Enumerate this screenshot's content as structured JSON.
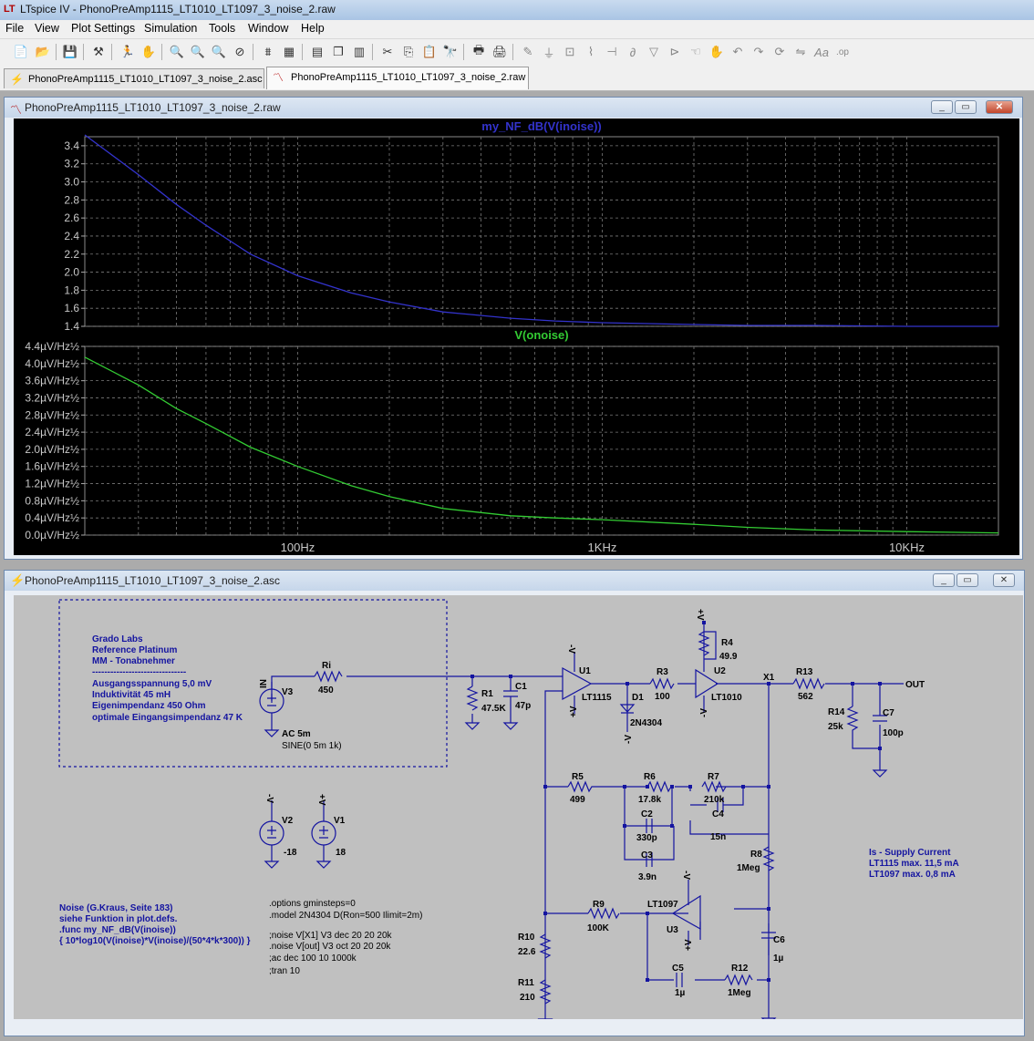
{
  "app": {
    "title": "LTspice IV - PhonoPreAmp1115_LT1010_LT1097_3_noise_2.raw",
    "icon_name": "ltspice-logo-icon"
  },
  "menu": [
    "File",
    "View",
    "Plot Settings",
    "Simulation",
    "Tools",
    "Window",
    "Help"
  ],
  "toolbar_icons": [
    "new-schematic-icon",
    "open-icon",
    "save-icon",
    "control-panel-icon",
    "run-icon",
    "halt-icon",
    "zoom-in-icon",
    "zoom-out-icon",
    "zoom-fit-icon",
    "zoom-cancel-icon",
    "autorange-icon",
    "grid-icon",
    "tile-horizontal-icon",
    "cascade-icon",
    "tile-vertical-icon",
    "cut-icon",
    "copy-icon",
    "paste-icon",
    "find-icon",
    "print-setup-icon",
    "print-icon",
    "wire-icon",
    "ground-icon",
    "label-icon",
    "resistor-icon",
    "capacitor-icon",
    "inductor-icon",
    "diode-icon",
    "component-icon",
    "move-icon",
    "drag-icon",
    "undo-icon",
    "redo-icon",
    "rotate-icon",
    "mirror-icon",
    "text-icon",
    "spice-directive-icon"
  ],
  "tabs": [
    {
      "label": "PhonoPreAmp1115_LT1010_LT1097_3_noise_2.asc",
      "icon": "schematic-icon",
      "active": false
    },
    {
      "label": "PhonoPreAmp1115_LT1010_LT1097_3_noise_2.raw",
      "icon": "waveform-icon",
      "active": true
    }
  ],
  "plot_window": {
    "title": "PhonoPreAmp1115_LT1010_LT1097_3_noise_2.raw",
    "buttons": [
      "_",
      "▭",
      "✕"
    ]
  },
  "schematic_window": {
    "title": "PhonoPreAmp1115_LT1010_LT1097_3_noise_2.asc",
    "buttons": [
      "_",
      "▭",
      "✕"
    ]
  },
  "chart_data": [
    {
      "type": "line",
      "title": "my_NF_dB(V(inoise))",
      "color": "#3333cc",
      "x_scale": "log",
      "xlim": [
        20,
        20000
      ],
      "ylim": [
        1.4,
        3.5
      ],
      "yticks": [
        "3.4",
        "3.2",
        "3.0",
        "2.8",
        "2.6",
        "2.4",
        "2.2",
        "2.0",
        "1.8",
        "1.6",
        "1.4"
      ],
      "ytick_values": [
        3.4,
        3.2,
        3.0,
        2.8,
        2.6,
        2.4,
        2.2,
        2.0,
        1.8,
        1.6,
        1.4
      ],
      "x": [
        20,
        30,
        40,
        50,
        70,
        100,
        150,
        200,
        300,
        500,
        700,
        1000,
        2000,
        3000,
        5000,
        10000,
        20000
      ],
      "y": [
        3.52,
        3.08,
        2.75,
        2.52,
        2.2,
        1.96,
        1.77,
        1.67,
        1.56,
        1.49,
        1.46,
        1.44,
        1.42,
        1.41,
        1.41,
        1.4,
        1.4
      ],
      "grid": true
    },
    {
      "type": "line",
      "title": "V(onoise)",
      "color": "#33cc33",
      "x_scale": "log",
      "xlim": [
        20,
        20000
      ],
      "ylim": [
        0,
        4.4
      ],
      "yticks": [
        "4.4µV/Hz½",
        "4.0µV/Hz½",
        "3.6µV/Hz½",
        "3.2µV/Hz½",
        "2.8µV/Hz½",
        "2.4µV/Hz½",
        "2.0µV/Hz½",
        "1.6µV/Hz½",
        "1.2µV/Hz½",
        "0.8µV/Hz½",
        "0.4µV/Hz½",
        "0.0µV/Hz½"
      ],
      "ytick_values": [
        4.4,
        4.0,
        3.6,
        3.2,
        2.8,
        2.4,
        2.0,
        1.6,
        1.2,
        0.8,
        0.4,
        0.0
      ],
      "x": [
        20,
        30,
        40,
        50,
        70,
        100,
        150,
        200,
        300,
        500,
        700,
        1000,
        2000,
        3000,
        5000,
        10000,
        20000
      ],
      "y": [
        4.15,
        3.5,
        2.95,
        2.6,
        2.05,
        1.6,
        1.15,
        0.9,
        0.62,
        0.45,
        0.4,
        0.36,
        0.25,
        0.18,
        0.12,
        0.08,
        0.05
      ],
      "grid": true,
      "xtick_labels": [
        "100Hz",
        "1KHz",
        "10KHz"
      ],
      "xtick_values": [
        100,
        1000,
        10000
      ]
    }
  ],
  "schematic": {
    "note_box": [
      "Grado Labs",
      "Reference Platinum",
      "MM - Tonabnehmer",
      "-------------------------------",
      "Ausgangsspannung 5,0 mV",
      "Induktivität 45 mH",
      "Eigenimpendanz 450 Ohm",
      "optimale Eingangsimpendanz 47 K"
    ],
    "noise_note": [
      "Noise (G.Kraus, Seite 183)",
      "siehe Funktion in  plot.defs.",
      ".func my_NF_dB(V(inoise))",
      "{ 10*log10(V(inoise)*V(inoise)/(50*4*k*300)) }"
    ],
    "directives": [
      ".options gminsteps=0",
      ".model 2N4304 D(Ron=500 Ilimit=2m)",
      "",
      ";noise V[X1] V3 dec 20 20 20k",
      ".noise V[out] V3 oct 20 20 20k",
      ";ac dec 100 10 1000k",
      ";tran 10"
    ],
    "supply_note": [
      "Is - Supply Current",
      "LT1115 max. 11,5 mA",
      "LT1097 max.   0,8 mA"
    ],
    "labels": {
      "V3": "V3",
      "IN": "IN",
      "V3_ac": "AC 5m",
      "V3_sine": "SINE(0 5m 1k)",
      "Ri": "Ri",
      "Ri_val": "450",
      "R1": "R1",
      "R1_val": "47.5K",
      "C1": "C1",
      "C1_val": "47p",
      "U1": "U1",
      "U1_part": "LT1115",
      "D1": "D1",
      "D1_part": "2N4304",
      "R3": "R3",
      "R3_val": "100",
      "R4": "R4",
      "R4_val": "49.9",
      "U2": "U2",
      "U2_part": "LT1010",
      "X1": "X1",
      "R13": "R13",
      "R13_val": "562",
      "R14": "R14",
      "R14_val": "25k",
      "C7": "C7",
      "C7_val": "100p",
      "OUT": "OUT",
      "R5": "R5",
      "R5_val": "499",
      "R6": "R6",
      "R6_val": "17.8k",
      "R7": "R7",
      "R7_val": "210k",
      "C2": "C2",
      "C2_val": "330p",
      "C3": "C3",
      "C3_val": "3.9n",
      "C4": "C4",
      "C4_val": "15n",
      "R8": "R8",
      "R8_val": "1Meg",
      "R9": "R9",
      "R9_val": "100K",
      "U3_part": "LT1097",
      "U3": "U3",
      "C6": "C6",
      "C6_val": "1µ",
      "R10": "R10",
      "R10_val": "22.6",
      "R11": "R11",
      "R11_val": "210",
      "C5": "C5",
      "C5_val": "1µ",
      "R12": "R12",
      "R12_val": "1Meg",
      "V2": "V2",
      "V2_val": "-18",
      "V1": "V1",
      "V1_val": "18",
      "minusV": "-V",
      "plusV": "+V"
    }
  }
}
